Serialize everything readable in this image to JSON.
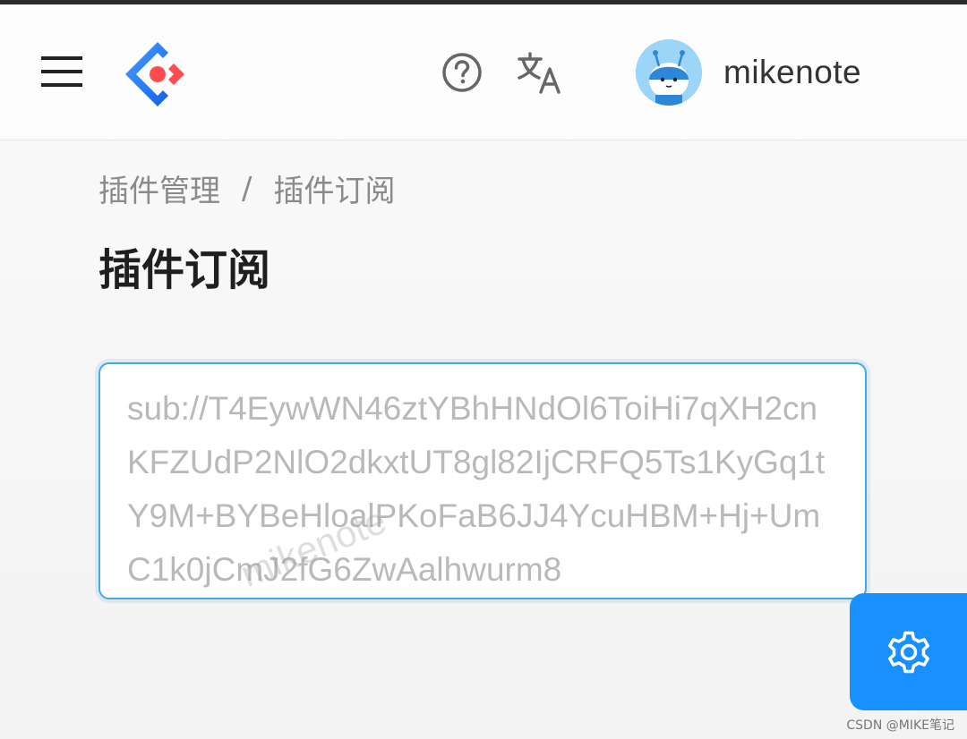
{
  "header": {
    "menu_icon": "hamburger-menu-icon",
    "logo_icon": "app-logo-icon",
    "help_icon": "question-circle-icon",
    "language_icon": "translate-icon",
    "user": {
      "avatar_icon": "user-avatar",
      "name": "mikenote"
    }
  },
  "breadcrumb": {
    "parent": "插件管理",
    "separator": "/",
    "current": "插件订阅"
  },
  "page_title": "插件订阅",
  "subscription": {
    "placeholder": "sub://T4EywWN46ztYBhHNdOl6ToiHi7qXH2cnKFZUdP2NlO2dkxtUT8gl82IjCRFQ5Ts1KyGq1tY9M+BYBeHloalPKoFaB6JJ4YcuHBM+Hj+UmC1k0jCmJ2fG6ZwAalhwurm8"
  },
  "watermark": "mikenote",
  "settings_fab_icon": "gear-icon",
  "credit": "CSDN @MIKE笔记",
  "colors": {
    "accent": "#1890ff",
    "input_border": "#4aa8e0",
    "logo_blue": "#1677ff",
    "logo_red": "#ff4d4f"
  }
}
